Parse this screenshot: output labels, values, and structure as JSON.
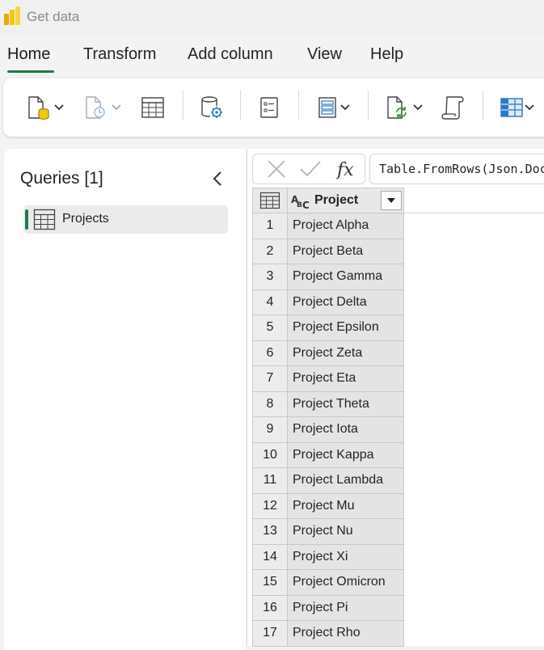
{
  "title": "Get data",
  "tabs": [
    {
      "label": "Home",
      "active": true
    },
    {
      "label": "Transform",
      "active": false
    },
    {
      "label": "Add column",
      "active": false
    },
    {
      "label": "View",
      "active": false
    },
    {
      "label": "Help",
      "active": false
    }
  ],
  "ribbon": {
    "buttons": [
      {
        "icon": "get-data-icon",
        "has_dropdown": true,
        "enabled": true
      },
      {
        "icon": "recent-sources-icon",
        "has_dropdown": true,
        "enabled": false
      },
      {
        "icon": "enter-data-table-icon",
        "has_dropdown": false,
        "enabled": true
      },
      {
        "icon": "data-source-settings-icon",
        "has_dropdown": false,
        "enabled": true
      },
      {
        "icon": "manage-parameters-icon",
        "has_dropdown": false,
        "enabled": true
      },
      {
        "icon": "options-list-icon",
        "has_dropdown": true,
        "enabled": true
      },
      {
        "icon": "refresh-icon",
        "has_dropdown": true,
        "enabled": true
      },
      {
        "icon": "advanced-editor-icon",
        "has_dropdown": false,
        "enabled": true
      },
      {
        "icon": "manage-columns-icon",
        "has_dropdown": true,
        "enabled": true
      }
    ]
  },
  "queries": {
    "title": "Queries [1]",
    "items": [
      {
        "label": "Projects",
        "selected": true
      }
    ]
  },
  "formula_bar": {
    "fx_label": "fx",
    "formula": "Table.FromRows(Json.Document(Binary.Decompress("
  },
  "grid": {
    "column_header": "Project",
    "column_type_icon": "text-type-icon",
    "rows": [
      {
        "num": "1",
        "value": "Project Alpha"
      },
      {
        "num": "2",
        "value": "Project Beta"
      },
      {
        "num": "3",
        "value": "Project Gamma"
      },
      {
        "num": "4",
        "value": "Project Delta"
      },
      {
        "num": "5",
        "value": "Project Epsilon"
      },
      {
        "num": "6",
        "value": "Project Zeta"
      },
      {
        "num": "7",
        "value": "Project Eta"
      },
      {
        "num": "8",
        "value": "Project Theta"
      },
      {
        "num": "9",
        "value": "Project Iota"
      },
      {
        "num": "10",
        "value": "Project Kappa"
      },
      {
        "num": "11",
        "value": "Project Lambda"
      },
      {
        "num": "12",
        "value": "Project Mu"
      },
      {
        "num": "13",
        "value": "Project Nu"
      },
      {
        "num": "14",
        "value": "Project Xi"
      },
      {
        "num": "15",
        "value": "Project Omicron"
      },
      {
        "num": "16",
        "value": "Project Pi"
      },
      {
        "num": "17",
        "value": "Project Rho"
      }
    ]
  },
  "colors": {
    "accent": "#1e7a4d",
    "brand": "#f2c811"
  }
}
